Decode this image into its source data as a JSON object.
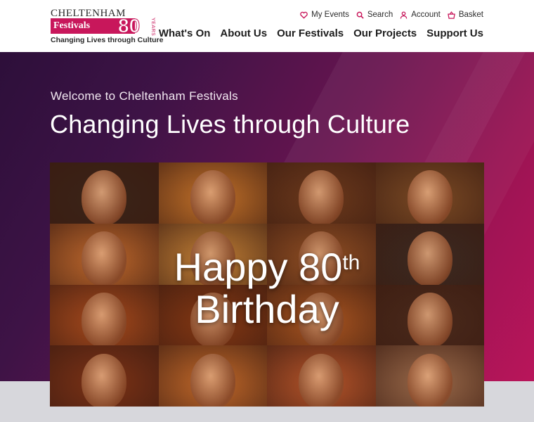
{
  "logo": {
    "name": "CHELTENHAM",
    "festivals": "Festivals",
    "anniversary": "80",
    "years": "YEARS",
    "tagline": "Changing Lives through Culture"
  },
  "utility_nav": [
    {
      "label": "My Events",
      "icon": "heart-icon"
    },
    {
      "label": "Search",
      "icon": "search-icon"
    },
    {
      "label": "Account",
      "icon": "user-icon"
    },
    {
      "label": "Basket",
      "icon": "basket-icon"
    }
  ],
  "main_nav": [
    "What's On",
    "About Us",
    "Our Festivals",
    "Our Projects",
    "Support Us"
  ],
  "hero": {
    "welcome": "Welcome to Cheltenham Festivals",
    "headline": "Changing Lives through Culture"
  },
  "video": {
    "line1": "Happy 80",
    "line1_sup": "th",
    "line2": "Birthday"
  },
  "colors": {
    "brand": "#c8175b",
    "hero_dark": "#2d0f3a",
    "hero_light": "#b9155a",
    "tiles": [
      "#3a2418",
      "#c7742a",
      "#6d3a1c",
      "#7a4a24",
      "#c26a2d",
      "#d08a3a",
      "#9a5426",
      "#3b2a22",
      "#a84a1c",
      "#8c3a14",
      "#b45a22",
      "#4a2a1c",
      "#7c3216",
      "#c46a2a",
      "#b8552a",
      "#9a6a4a"
    ]
  }
}
